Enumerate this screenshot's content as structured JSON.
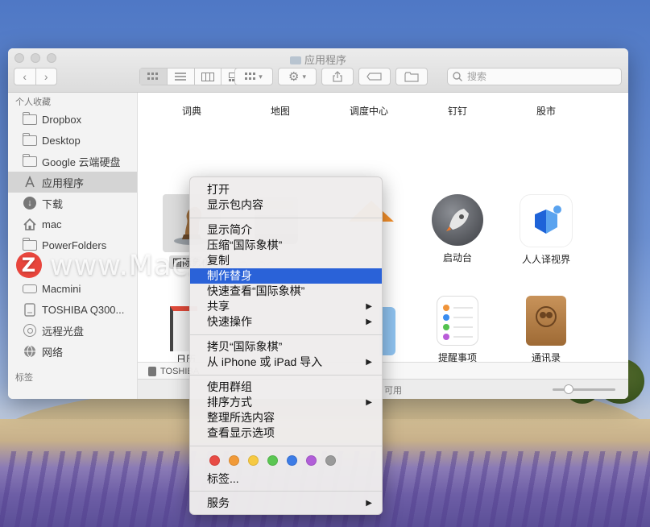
{
  "window": {
    "title": "应用程序"
  },
  "search": {
    "placeholder": "搜索"
  },
  "sidebar": {
    "favorites_header": "个人收藏",
    "favorites": [
      {
        "label": "Dropbox",
        "icon": "folder-icon"
      },
      {
        "label": "Desktop",
        "icon": "folder-icon"
      },
      {
        "label": "Google 云端硬盘",
        "icon": "folder-icon"
      },
      {
        "label": "应用程序",
        "icon": "applications-icon"
      },
      {
        "label": "下载",
        "icon": "downloads-icon"
      },
      {
        "label": "mac",
        "icon": "home-icon"
      },
      {
        "label": "PowerFolders",
        "icon": "folder-icon"
      }
    ],
    "locations": [
      {
        "label": "Macmini",
        "icon": "drive-icon"
      },
      {
        "label": "TOSHIBA Q300...",
        "icon": "external-drive-icon"
      },
      {
        "label": "远程光盘",
        "icon": "disc-icon"
      },
      {
        "label": "网络",
        "icon": "network-icon"
      }
    ],
    "tags_header": "标签"
  },
  "apps": {
    "row1": [
      "词典",
      "地图",
      "调度中心",
      "钉钉",
      "股市"
    ],
    "row2": [
      "国际象棋",
      "启动台",
      "人人译视界"
    ],
    "row3": [
      "日历",
      "提醒事项",
      "通讯录"
    ]
  },
  "pathbar": {
    "text": "TOSHIBA"
  },
  "statusbar": {
    "text": "可用"
  },
  "zoom": {
    "value": 0.25
  },
  "context_menu": {
    "open": "打开",
    "show_package": "显示包内容",
    "get_info": "显示简介",
    "compress": "压缩“国际象棋”",
    "duplicate": "复制",
    "make_alias": "制作替身",
    "quick_look": "快速查看“国际象棋”",
    "share": "共享",
    "quick_actions": "快速操作",
    "copy": "拷贝“国际象棋”",
    "import_iphone": "从 iPhone 或 iPad 导入",
    "use_groups": "使用群组",
    "sort_by": "排序方式",
    "clean_up": "整理所选内容",
    "view_options": "查看显示选项",
    "tags": "标签...",
    "services": "服务",
    "tag_colors": [
      "#e84b45",
      "#f19a38",
      "#f6c942",
      "#5bc653",
      "#3d7ce6",
      "#b15ed8",
      "#9a9a9a"
    ]
  },
  "watermark": {
    "logo": "Z",
    "text": "www.MacZ.com"
  }
}
